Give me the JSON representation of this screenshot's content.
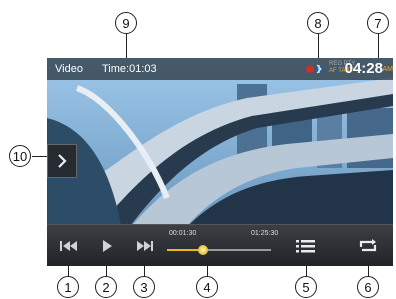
{
  "status_bar": {
    "mode": "Video",
    "time_label": "Time:01:03",
    "clock": "04:28",
    "ampm": "AM",
    "rds_top": "REG PTY",
    "rds_bottom": "AF TA TP"
  },
  "progress": {
    "elapsed": "00:01:30",
    "total": "01:25:30",
    "fraction": 0.35
  },
  "callouts": [
    "1",
    "2",
    "3",
    "4",
    "5",
    "6",
    "7",
    "8",
    "9",
    "10"
  ],
  "icons": {
    "prev": "skip-previous-icon",
    "play": "play-icon",
    "next": "skip-next-icon",
    "list": "list-icon",
    "repeat": "repeat-icon",
    "side": "chevron-right-icon"
  },
  "colors": {
    "accent": "#f3b51d",
    "bar": "#202326"
  }
}
